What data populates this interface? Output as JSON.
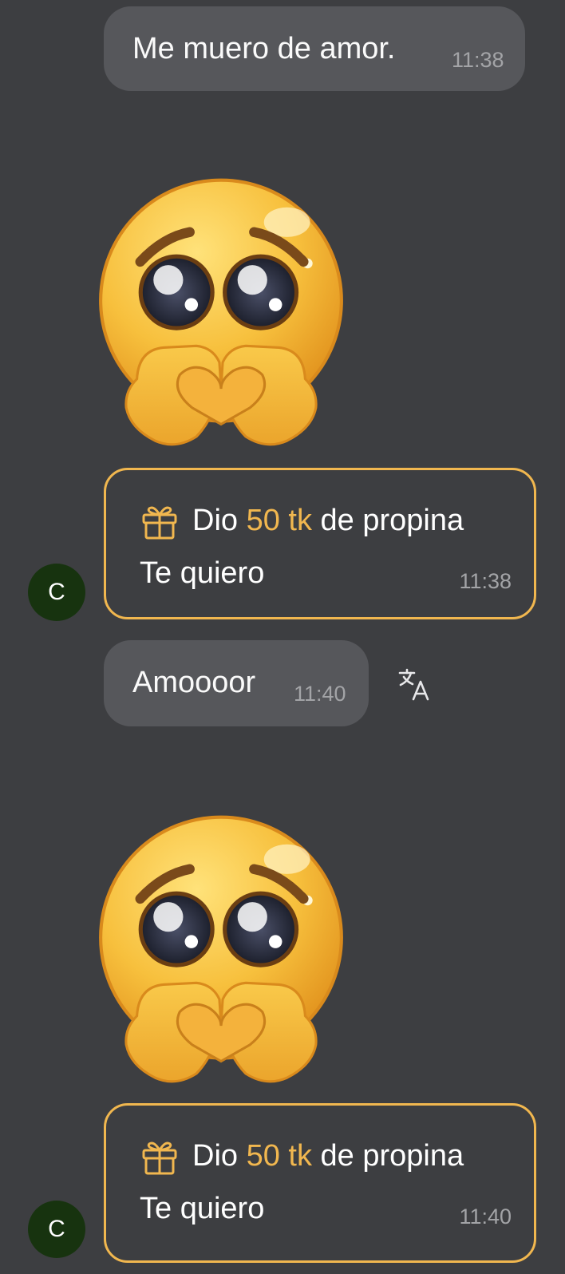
{
  "messages": [
    {
      "text": "Me muero de amor.",
      "time": "11:38"
    },
    {
      "text": "Amoooor",
      "time": "11:40"
    }
  ],
  "tips": [
    {
      "prefix": "Dio ",
      "amount": "50 tk",
      "suffix": " de propina",
      "message": "Te quiero",
      "time": "11:38",
      "avatar": "C"
    },
    {
      "prefix": "Dio ",
      "amount": "50 tk",
      "suffix": " de propina",
      "message": "Te quiero",
      "time": "11:40",
      "avatar": "C"
    }
  ],
  "icons": {
    "emoji": "pleading-face-hands-heart-icon",
    "gift": "gift-icon",
    "translate": "translate-icon"
  },
  "colors": {
    "background": "#3d3e41",
    "bubble": "#56575b",
    "accent": "#f1b74f",
    "avatar": "#17330f"
  }
}
